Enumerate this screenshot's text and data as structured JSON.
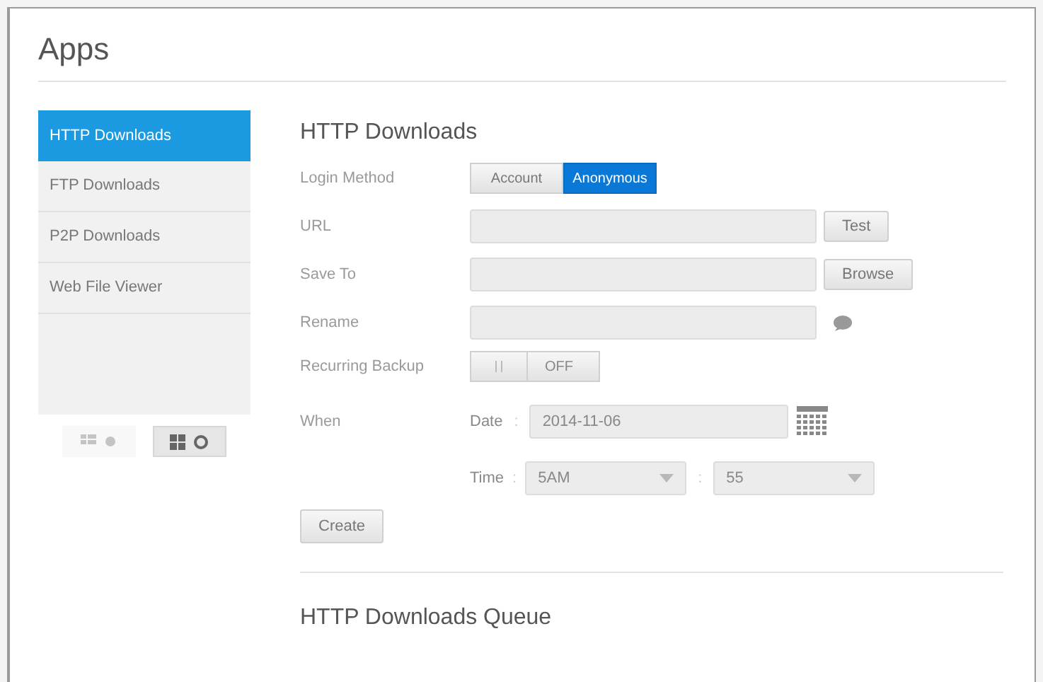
{
  "page": {
    "title": "Apps"
  },
  "sidebar": {
    "items": [
      {
        "label": "HTTP Downloads",
        "selected": true
      },
      {
        "label": "FTP Downloads",
        "selected": false
      },
      {
        "label": "P2P Downloads",
        "selected": false
      },
      {
        "label": "Web File Viewer",
        "selected": false
      }
    ]
  },
  "view_toggles": [
    {
      "kind": "list",
      "selected": false
    },
    {
      "kind": "grid",
      "selected": true
    }
  ],
  "form": {
    "heading": "HTTP Downloads",
    "login_method": {
      "label": "Login Method",
      "options": [
        {
          "label": "Account",
          "selected": false
        },
        {
          "label": "Anonymous",
          "selected": true
        }
      ]
    },
    "url": {
      "label": "URL",
      "button": "Test"
    },
    "save_to": {
      "label": "Save To",
      "button": "Browse"
    },
    "rename": {
      "label": "Rename"
    },
    "recurring_backup": {
      "label": "Recurring Backup",
      "on": false,
      "state_text": "OFF"
    },
    "when": {
      "label": "When",
      "date_label": "Date",
      "date_separator": ":",
      "date": "2014-11-06",
      "time_label": "Time",
      "time_separator": ":",
      "hour": "5AM",
      "hour_minute_separator": ":",
      "minute": "55"
    },
    "create_button": "Create"
  },
  "queue": {
    "heading": "HTTP Downloads Queue"
  }
}
